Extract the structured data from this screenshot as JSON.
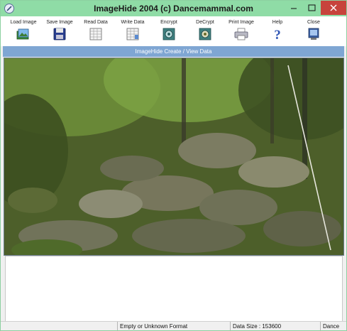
{
  "window": {
    "title": "ImageHide 2004 (c) Dancemammal.com"
  },
  "toolbar": {
    "items": [
      {
        "label": "Load Image",
        "icon": "load-image-icon"
      },
      {
        "label": "Save Image",
        "icon": "floppy-disk-icon"
      },
      {
        "label": "Read Data",
        "icon": "read-data-icon"
      },
      {
        "label": "Write Data",
        "icon": "write-data-icon"
      },
      {
        "label": "Encrypt",
        "icon": "encrypt-icon"
      },
      {
        "label": "DeCrypt",
        "icon": "decrypt-icon"
      },
      {
        "label": "Print Image",
        "icon": "printer-icon"
      },
      {
        "label": "Help",
        "icon": "help-icon"
      },
      {
        "label": "Close",
        "icon": "close-app-icon"
      }
    ]
  },
  "panel": {
    "header": "ImageHide Create / View Data"
  },
  "data_area": {
    "value": ""
  },
  "status": {
    "format": "Empty or Unknown Format",
    "data_size": "Data Size : 153600",
    "brand": "Dance"
  },
  "colors": {
    "titlebar": "#8fdca6",
    "header": "#7fa6d3",
    "close_button": "#c7433c"
  }
}
